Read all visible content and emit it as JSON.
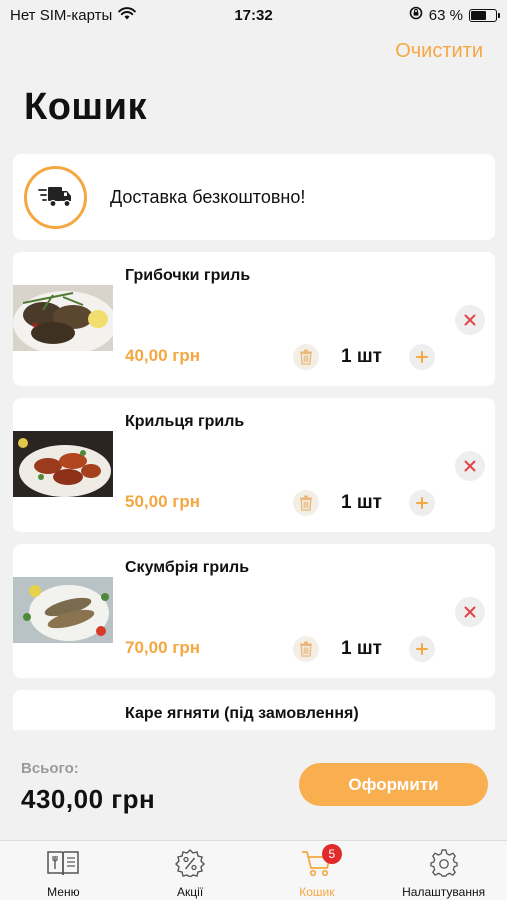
{
  "status_bar": {
    "carrier": "Нет SIM-карты",
    "time": "17:32",
    "battery": "63 %",
    "battery_level": 0.63
  },
  "header": {
    "clear_label": "Очистити",
    "title": "Кошик"
  },
  "delivery": {
    "text": "Доставка безкоштовно!",
    "icon": "delivery-truck-icon"
  },
  "items": [
    {
      "name": "Грибочки гриль",
      "price": "40,00 грн",
      "quantity": "1 шт"
    },
    {
      "name": "Крильця гриль",
      "price": "50,00 грн",
      "quantity": "1 шт"
    },
    {
      "name": "Скумбрія гриль",
      "price": "70,00 грн",
      "quantity": "1 шт"
    },
    {
      "name": "Каре ягняти (під замовлення)",
      "price": "",
      "quantity": ""
    }
  ],
  "footer": {
    "total_label": "Всього:",
    "total_value": "430,00 грн",
    "checkout_label": "Оформити"
  },
  "tabbar": {
    "tabs": [
      {
        "label": "Меню",
        "icon": "menu-book-icon"
      },
      {
        "label": "Акції",
        "icon": "discount-icon"
      },
      {
        "label": "Кошик",
        "icon": "cart-icon",
        "badge": "5",
        "active": true
      },
      {
        "label": "Налаштування",
        "icon": "gear-icon"
      }
    ]
  },
  "colors": {
    "accent": "#f5a742",
    "button": "#f9ae4f",
    "badge": "#e12b2b",
    "remove": "#e0474c"
  }
}
